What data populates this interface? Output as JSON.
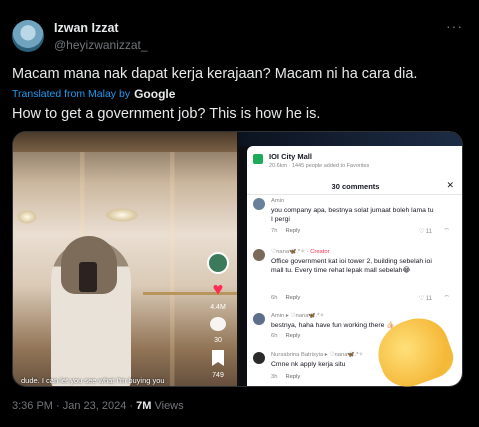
{
  "author": {
    "name": "Izwan Izzat",
    "handle": "@heyizwanizzat_"
  },
  "tweet": {
    "text": "Macam mana nak dapat kerja kerajaan? Macam ni ha cara dia.",
    "translated_label": "Translated from Malay by",
    "translator": "Google",
    "translation": "How to get a government job? This is how he is."
  },
  "media": {
    "left": {
      "caption": "dude. I can let you see what I'm buying you",
      "likes": "4.4M",
      "comments": "30",
      "saves": "749"
    },
    "right": {
      "location_title": "IOI City Mall",
      "location_sub": "20.6km · 1445 people added to Favorites",
      "comments_title": "30 comments",
      "comments": [
        {
          "author": "Amin",
          "creator": "",
          "text": "you company apa, bestnya solat jumaat boleh lama tu I pergi",
          "time": "7h",
          "reply": "Reply",
          "likes": "11"
        },
        {
          "author": "♡nana🦋.*✧",
          "creator": "· Creator",
          "text": "Office government kat ioi tower 2, building sebelah ioi mall tu. Every time rehat lepak mall sebelah😂",
          "time": "6h",
          "reply": "Reply",
          "likes": "11"
        },
        {
          "author": "Amin ▸ ♡nana🦋.*✧",
          "creator": "",
          "text": "bestnya, haha have fun working there 👍🏻",
          "time": "6h",
          "reply": "Reply",
          "likes": ""
        },
        {
          "author": "Nursabrina Batrisyia ▸ ♡nana🦋.*✧",
          "creator": "",
          "text": "Cmne nk apply kerja situ",
          "time": "3h",
          "reply": "Reply",
          "likes": ""
        }
      ]
    }
  },
  "footer": {
    "time": "3:36 PM · Jan 23, 2024 ·",
    "views_count": "7M",
    "views_label": "Views"
  }
}
